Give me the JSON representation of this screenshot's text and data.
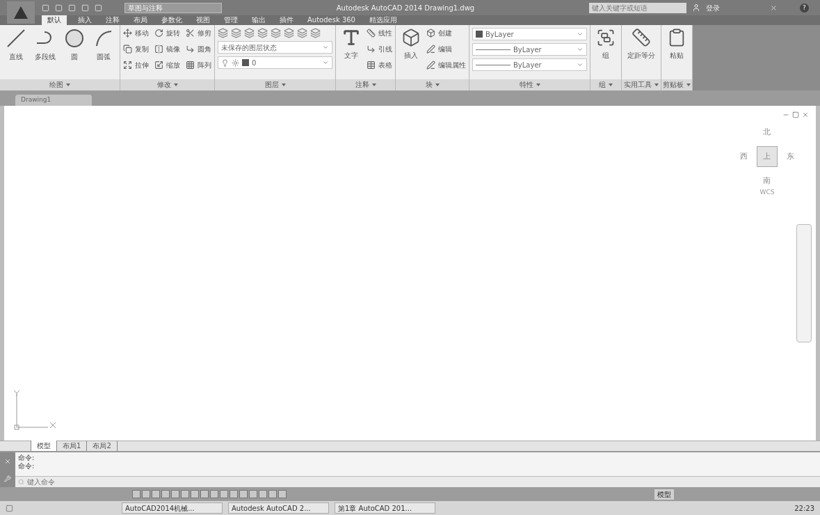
{
  "titlebar": {
    "workspace": "草图与注释",
    "title": "Autodesk AutoCAD 2014  Drawing1.dwg",
    "search_placeholder": "键入关键字或短语",
    "login": "登录",
    "help": "?"
  },
  "ribbon_tabs": [
    {
      "label": "默认",
      "selected": true
    },
    {
      "label": "插入",
      "selected": false
    },
    {
      "label": "注释",
      "selected": false
    },
    {
      "label": "布局",
      "selected": false
    },
    {
      "label": "参数化",
      "selected": false
    },
    {
      "label": "视图",
      "selected": false
    },
    {
      "label": "管理",
      "selected": false
    },
    {
      "label": "输出",
      "selected": false
    },
    {
      "label": "插件",
      "selected": false
    },
    {
      "label": "Autodesk 360",
      "selected": false
    },
    {
      "label": "精选应用",
      "selected": false
    }
  ],
  "panels": [
    {
      "title": "绘图",
      "items": [
        {
          "kind": "large",
          "label": "直线"
        },
        {
          "kind": "large",
          "label": "多段线"
        },
        {
          "kind": "large",
          "label": "圆"
        },
        {
          "kind": "large",
          "label": "圆弧"
        }
      ]
    },
    {
      "title": "修改",
      "items": [
        {
          "kind": "small",
          "label": "移动"
        },
        {
          "kind": "small",
          "label": "复制"
        },
        {
          "kind": "small",
          "label": "拉伸"
        },
        {
          "kind": "small",
          "label": "旋转"
        },
        {
          "kind": "small",
          "label": "镜像"
        },
        {
          "kind": "small",
          "label": "缩放"
        },
        {
          "kind": "small",
          "label": "修剪"
        },
        {
          "kind": "small",
          "label": "圆角"
        },
        {
          "kind": "small",
          "label": "阵列"
        }
      ]
    },
    {
      "title": "图层",
      "items": [
        {
          "kind": "field",
          "label": "未保存的图层状态"
        },
        {
          "kind": "field",
          "label": "0"
        }
      ]
    },
    {
      "title": "注释",
      "items": [
        {
          "kind": "large",
          "label": "文字"
        },
        {
          "kind": "small",
          "label": "线性"
        },
        {
          "kind": "small",
          "label": "引线"
        },
        {
          "kind": "small",
          "label": "表格"
        }
      ]
    },
    {
      "title": "块",
      "items": [
        {
          "kind": "large",
          "label": "插入"
        },
        {
          "kind": "small",
          "label": "创建"
        },
        {
          "kind": "small",
          "label": "编辑"
        },
        {
          "kind": "small",
          "label": "编辑属性"
        }
      ]
    },
    {
      "title": "特性",
      "items": [
        {
          "kind": "field",
          "label": "ByLayer"
        },
        {
          "kind": "field",
          "label": "ByLayer"
        },
        {
          "kind": "field",
          "label": "ByLayer"
        }
      ]
    },
    {
      "title": "组",
      "items": [
        {
          "kind": "large",
          "label": "组"
        }
      ]
    },
    {
      "title": "实用工具",
      "items": [
        {
          "kind": "large",
          "label": "定距等分"
        }
      ]
    },
    {
      "title": "剪贴板",
      "items": [
        {
          "kind": "large",
          "label": "粘贴"
        }
      ]
    }
  ],
  "document_tab": "Drawing1",
  "viewcube": {
    "north": "北",
    "west": "西",
    "top": "上",
    "east": "东",
    "south": "南",
    "wcs": "WCS"
  },
  "layout_tabs": [
    {
      "label": "模型",
      "selected": true
    },
    {
      "label": "布局1",
      "selected": false
    },
    {
      "label": "布局2",
      "selected": false
    }
  ],
  "command_lines": [
    "命令:",
    "命令:"
  ],
  "command_placeholder": "键入命令",
  "status_model": "模型",
  "taskbar": {
    "windows": [
      "AutoCAD2014机械...",
      "Autodesk AutoCAD 2...",
      "第1章 AutoCAD 201..."
    ],
    "time": "22:23"
  }
}
